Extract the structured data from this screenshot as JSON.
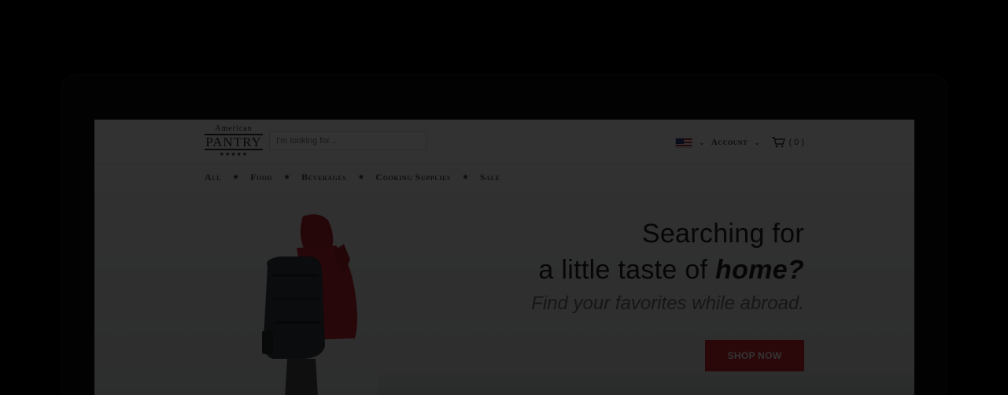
{
  "logo": {
    "line1": "American",
    "line2": "PANTRY",
    "line3": "★★★★★"
  },
  "search": {
    "placeholder": "I'm looking for..."
  },
  "header": {
    "account_label": "Account",
    "cart_count": "( 0 )"
  },
  "nav": {
    "items": [
      "All",
      "Food",
      "Beverages",
      "Cooking Supplies",
      "Sale"
    ],
    "separator": "★"
  },
  "hero": {
    "line1": "Searching for",
    "line2_prefix": "a little taste of ",
    "line2_emph": "home?",
    "subtitle": "Find your favorites while abroad.",
    "cta": "SHOP NOW"
  },
  "colors": {
    "brand_red": "#d3292e",
    "overlay": "rgba(0,0,0,0.80)"
  },
  "icons": [
    "us-flag-icon",
    "chevron-down-icon",
    "cart-icon",
    "star-icon"
  ]
}
